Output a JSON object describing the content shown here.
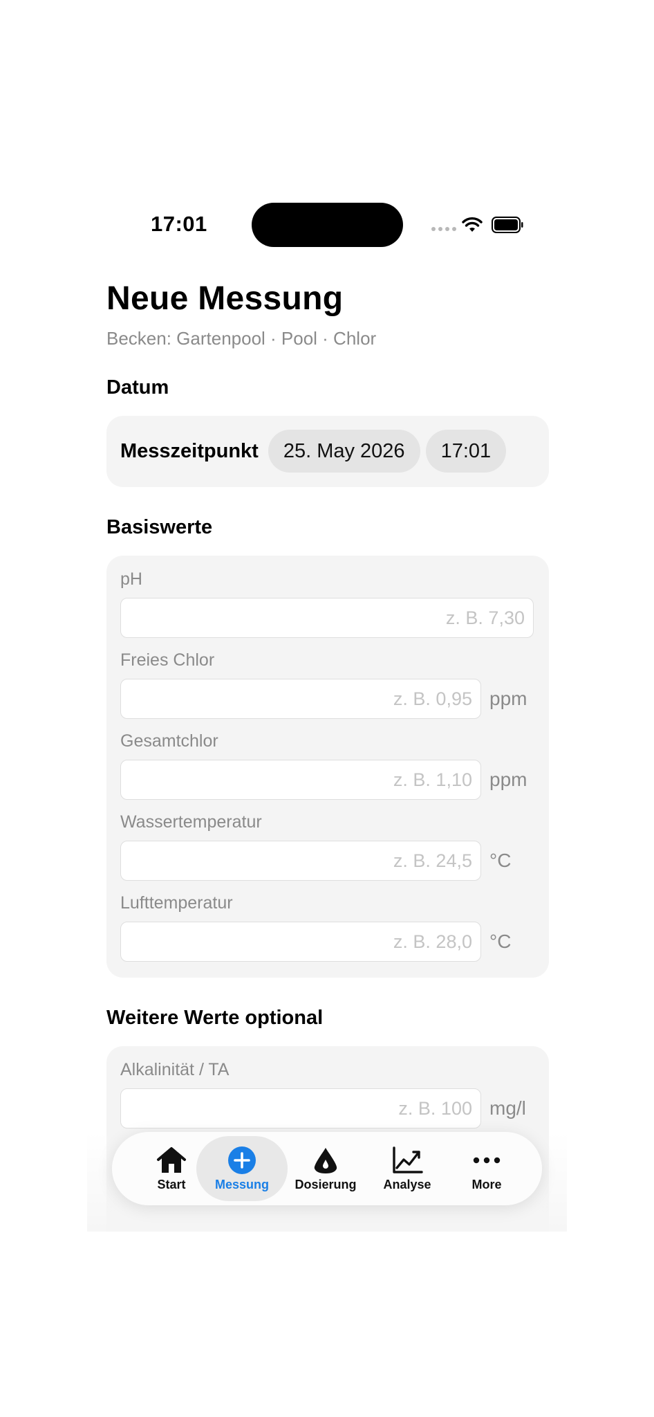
{
  "status_bar": {
    "time": "17:01"
  },
  "header": {
    "title": "Neue Messung",
    "subtitle": "Becken: Gartenpool · Pool · Chlor"
  },
  "datum": {
    "section_title": "Datum",
    "label": "Messzeitpunkt",
    "date": "25. May 2026",
    "time": "17:01"
  },
  "basiswerte": {
    "section_title": "Basiswerte",
    "fields": [
      {
        "label": "pH",
        "value": "",
        "placeholder": "z. B. 7,30",
        "unit": ""
      },
      {
        "label": "Freies Chlor",
        "value": "",
        "placeholder": "z. B. 0,95",
        "unit": "ppm"
      },
      {
        "label": "Gesamtchlor",
        "value": "",
        "placeholder": "z. B. 1,10",
        "unit": "ppm"
      },
      {
        "label": "Wassertemperatur",
        "value": "",
        "placeholder": "z. B. 24,5",
        "unit": "°C"
      },
      {
        "label": "Lufttemperatur",
        "value": "",
        "placeholder": "z. B. 28,0",
        "unit": "°C"
      }
    ]
  },
  "weitere": {
    "section_title": "Weitere Werte optional",
    "fields": [
      {
        "label": "Alkalinität / TA",
        "value": "",
        "placeholder": "z. B. 100",
        "unit": "mg/l"
      }
    ]
  },
  "tabbar": {
    "active_color": "#1a7fe6",
    "items": [
      {
        "label": "Start",
        "icon": "house-icon"
      },
      {
        "label": "Messung",
        "icon": "plus-circle-icon",
        "active": true
      },
      {
        "label": "Dosierung",
        "icon": "drop-icon"
      },
      {
        "label": "Analyse",
        "icon": "chart-line-icon"
      },
      {
        "label": "More",
        "icon": "ellipsis-icon"
      }
    ]
  }
}
